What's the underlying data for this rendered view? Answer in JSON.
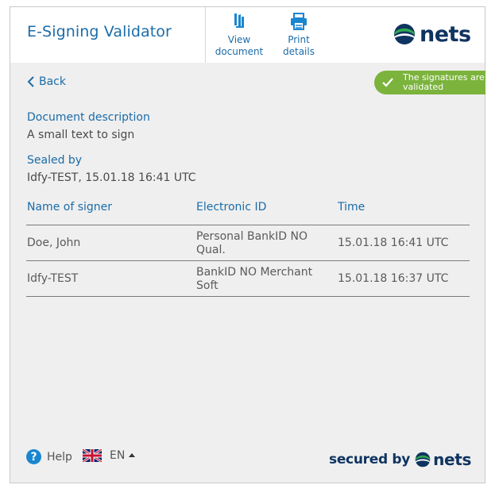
{
  "header": {
    "title": "E-Signing Validator",
    "view_document": "View\ndocument",
    "print_details": "Print\ndetails",
    "brand": "nets"
  },
  "nav": {
    "back": "Back"
  },
  "status_badge": {
    "text": "The signatures are validated",
    "color": "#7bb33c"
  },
  "document": {
    "description_label": "Document description",
    "description_value": "A small text to sign",
    "sealed_label": "Sealed by",
    "sealed_value": "Idfy-TEST, 15.01.18 16:41 UTC"
  },
  "signers": {
    "columns": [
      "Name of signer",
      "Electronic ID",
      "Time"
    ],
    "rows": [
      {
        "name": "Doe, John",
        "eid": "Personal BankID NO Qual.",
        "time": "15.01.18 16:41 UTC"
      },
      {
        "name": "Idfy-TEST",
        "eid": "BankID NO Merchant Soft",
        "time": "15.01.18 16:37 UTC"
      }
    ]
  },
  "footer": {
    "help": "Help",
    "language": "EN",
    "secured_by": "secured by",
    "brand": "nets"
  },
  "colors": {
    "accent": "#1b6ca8",
    "brand_dark": "#0f3460",
    "brand_green": "#2fa84f"
  },
  "icons": [
    "view-document-icon",
    "print-icon",
    "nets-logo-icon",
    "chevron-left-icon",
    "checkmark-icon",
    "help-icon",
    "uk-flag-icon",
    "caret-up-icon"
  ]
}
